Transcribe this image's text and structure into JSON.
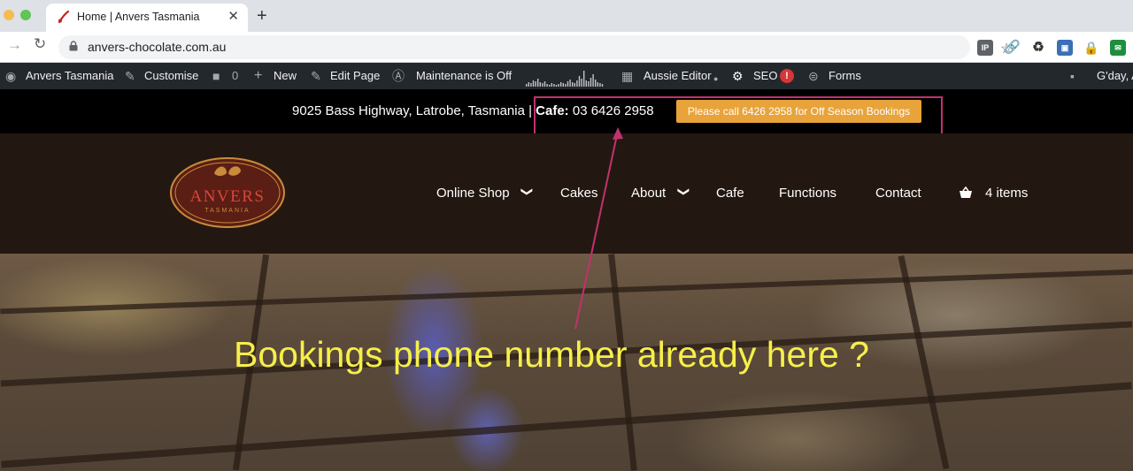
{
  "browser": {
    "tab_title": "Home | Anvers Tasmania",
    "url": "anvers-chocolate.com.au",
    "new_tab_glyph": "+",
    "close_glyph": "✕"
  },
  "adminbar": {
    "site_name": "Anvers Tasmania",
    "customise": "Customise",
    "comments_count": "0",
    "new": "New",
    "edit_page": "Edit Page",
    "maintenance": "Maintenance is Off",
    "aussie_editor": "Aussie Editor",
    "seo": "SEO",
    "seo_badge": "!",
    "forms": "Forms",
    "greeting": "G'day, A"
  },
  "infobar": {
    "address": "9025 Bass Highway, Latrobe, Tasmania | ",
    "cafe_label": "Cafe:",
    "cafe_phone": " 03 6426 2958",
    "booking_button": "Please call 6426 2958 for Off Season Bookings"
  },
  "logo": {
    "name": "ANVERS",
    "sub": "TASMANIA"
  },
  "nav": {
    "items": [
      {
        "label": "Online Shop",
        "has_dropdown": true
      },
      {
        "label": "Cakes",
        "has_dropdown": false
      },
      {
        "label": "About",
        "has_dropdown": true
      },
      {
        "label": "Cafe",
        "has_dropdown": false
      },
      {
        "label": "Functions",
        "has_dropdown": false
      },
      {
        "label": "Contact",
        "has_dropdown": false
      }
    ],
    "cart": "4 items"
  },
  "annotation": {
    "caption": "Bookings phone number already here ?",
    "caption_color": "#f6ef4a",
    "box_color": "#c0326e"
  },
  "colors": {
    "adminbar": "#23282d",
    "infobar": "#000000",
    "header": "#231811",
    "booking_button": "#e8a33a"
  }
}
